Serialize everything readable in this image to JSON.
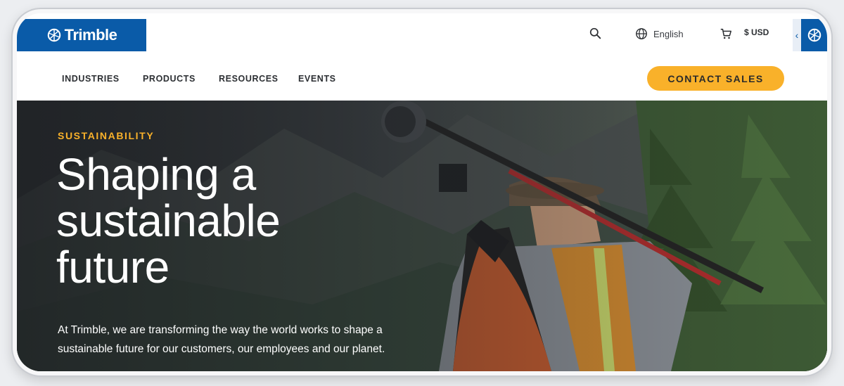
{
  "brand": {
    "name": "Trimble",
    "color": "#0a5ba8"
  },
  "utility": {
    "search_icon": "search-icon",
    "language": "English",
    "currency": "$ USD"
  },
  "nav": {
    "items": [
      "INDUSTRIES",
      "PRODUCTS",
      "RESOURCES",
      "EVENTS"
    ],
    "cta": "CONTACT SALES",
    "cta_color": "#f9b12a"
  },
  "hero": {
    "eyebrow": "SUSTAINABILITY",
    "headline_lines": [
      "Shaping a",
      "sustainable",
      "future"
    ],
    "body_lines": [
      "At Trimble, we are transforming the way the world works to shape a",
      "sustainable future for our customers, our employees and our planet."
    ]
  }
}
